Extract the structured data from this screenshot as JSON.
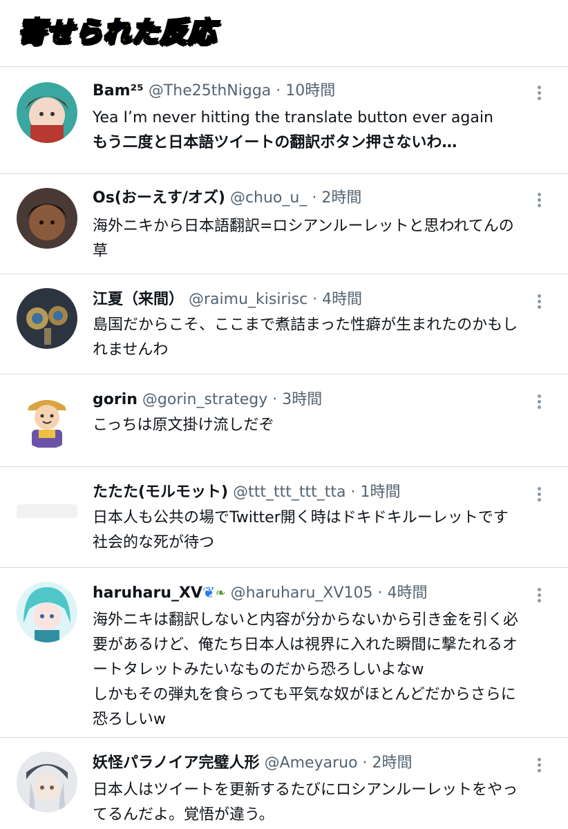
{
  "banner": {
    "title": "寄せられた反応"
  },
  "tweets": [
    {
      "name": "Bam²⁵",
      "handle": "@The25thNigga",
      "time": "10時間",
      "lines": [
        "Yea I’m never hitting the translate button ever again",
        "もう二度と日本語ツイートの翻訳ボタン押さないわ…"
      ]
    },
    {
      "name": "Os(おーえす/オズ)",
      "handle": "@chuo_u_",
      "time": "2時間",
      "lines": [
        "海外ニキから日本語翻訳=ロシアンルーレットと思われてんの",
        "草"
      ]
    },
    {
      "name": "江夏（来間）",
      "handle": "@raimu_kisirisc",
      "time": "4時間",
      "lines": [
        "島国だからこそ、ここまで煮詰まった性癖が生まれたのかもし",
        "れませんわ"
      ]
    },
    {
      "name": "gorin",
      "handle": "@gorin_strategy",
      "time": "3時間",
      "lines": [
        "こっちは原文掛け流しだぞ"
      ]
    },
    {
      "name": "たたた(モルモット)",
      "handle": "@ttt_ttt_ttt_tta",
      "time": "1時間",
      "lines": [
        "日本人も公共の場でTwitter開く時はドキドキルーレットです",
        "社会的な死が待つ"
      ]
    },
    {
      "name": "haruharu_XV",
      "handle": "@haruharu_XV105",
      "time": "4時間",
      "lines": [
        "海外ニキは翻訳しないと内容が分からないから引き金を引く必",
        "要があるけど、俺たち日本人は視界に入れた瞬間に撃たれるオ",
        "ートタレットみたいなものだから恐ろしいよなw",
        "しかもその弾丸を食らっても平気な奴がほとんどだからさらに",
        "恐ろしいw"
      ]
    },
    {
      "name": "妖怪パラノイア完璧人形",
      "handle": "@Ameyaruo",
      "time": "2時間",
      "lines": [
        "日本人はツイートを更新するたびにロシアンルーレットをやっ",
        "てるんだよ。覚悟が違う。"
      ]
    }
  ],
  "sep": "·",
  "icons": {
    "more": "more-vertical-icon",
    "butterfly": "butterfly-emoji-icon",
    "leaf": "leaf-emoji-icon"
  },
  "colors": {
    "secondary_text": "#536471",
    "divider": "#cfd9de",
    "banner_yellow": "#f2c200"
  }
}
